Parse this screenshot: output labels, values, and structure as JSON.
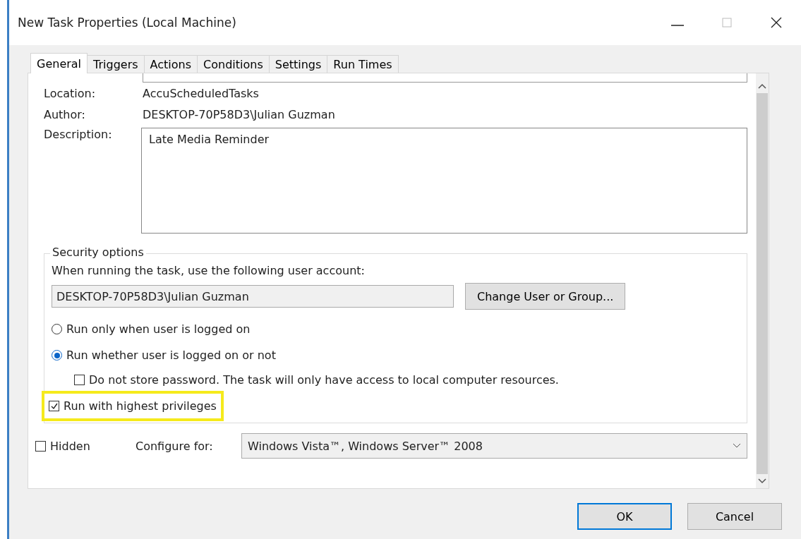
{
  "window": {
    "title": "New Task Properties (Local Machine)"
  },
  "tabs": [
    {
      "label": "General",
      "selected": true
    },
    {
      "label": "Triggers",
      "selected": false
    },
    {
      "label": "Actions",
      "selected": false
    },
    {
      "label": "Conditions",
      "selected": false
    },
    {
      "label": "Settings",
      "selected": false
    },
    {
      "label": "Run Times",
      "selected": false
    }
  ],
  "general": {
    "fields": [
      {
        "label": "Location:",
        "value": "AccuScheduledTasks"
      },
      {
        "label": "Author:",
        "value": "DESKTOP-70P58D3\\Julian Guzman"
      }
    ],
    "description": {
      "label": "Description:",
      "value": "Late Media Reminder"
    }
  },
  "security": {
    "legend": "Security options",
    "prompt": "When running the task, use the following user account:",
    "account": "DESKTOP-70P58D3\\Julian Guzman",
    "change_button": "Change User or Group...",
    "radios": [
      {
        "label": "Run only when user is logged on",
        "selected": false
      },
      {
        "label": "Run whether user is logged on or not",
        "selected": true
      }
    ],
    "no_password": {
      "label": "Do not store password. The task will only have access to local computer resources.",
      "checked": false
    },
    "highest": {
      "label": "Run with highest privileges",
      "checked": true,
      "highlighted": true
    }
  },
  "hidden": {
    "label": "Hidden",
    "checked": false
  },
  "configure": {
    "label": "Configure for:",
    "value": "Windows Vista™, Windows Server™ 2008"
  },
  "buttons": [
    {
      "label": "OK",
      "default": true
    },
    {
      "label": "Cancel",
      "default": false
    }
  ]
}
